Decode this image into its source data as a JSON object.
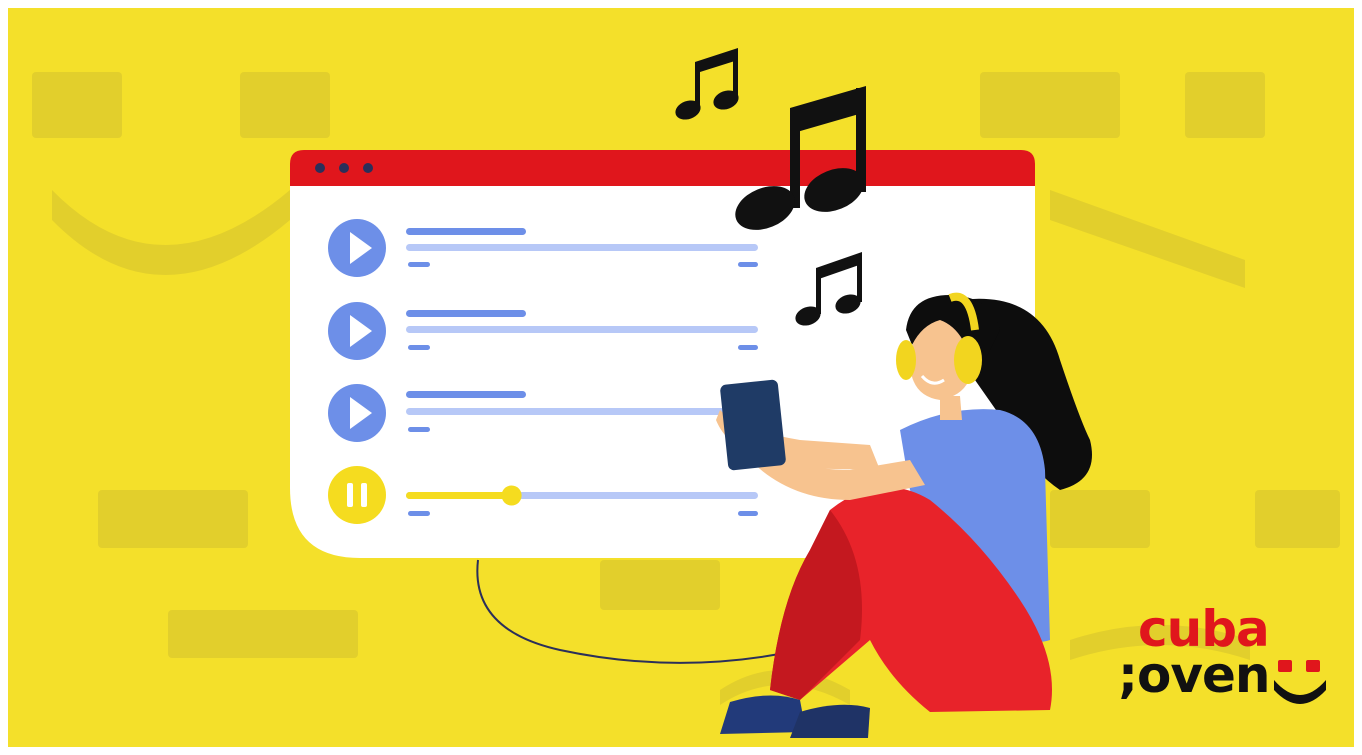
{
  "colors": {
    "background": "#f4e02a",
    "background_shape": "#e2cf2c",
    "player_header": "#e0161c",
    "player_body": "#ffffff",
    "play_button": "#6d8fe8",
    "pause_button": "#f5dc1f",
    "track_line": "#b7c8f7",
    "track_title": "#6d8fe8",
    "note": "#111111",
    "shirt": "#6d8fe8",
    "pants": "#e8232a",
    "hair": "#0d0d0d",
    "skin": "#f7c38f",
    "tablet": "#1f3b66",
    "headphones": "#f2d51f",
    "logo_red": "#e0161c",
    "logo_black": "#111111"
  },
  "player": {
    "window_dots": 3,
    "tracks": [
      {
        "state": "play",
        "icon": "play-icon"
      },
      {
        "state": "play",
        "icon": "play-icon"
      },
      {
        "state": "play",
        "icon": "play-icon"
      },
      {
        "state": "playing",
        "icon": "pause-icon",
        "progress": 0.3
      }
    ]
  },
  "decorations": {
    "notes": [
      "double-eighth-note-icon",
      "double-eighth-note-icon",
      "double-eighth-note-icon"
    ]
  },
  "logo": {
    "line1": "cuba",
    "line2": ";oven",
    "mark": "smile-icon"
  }
}
